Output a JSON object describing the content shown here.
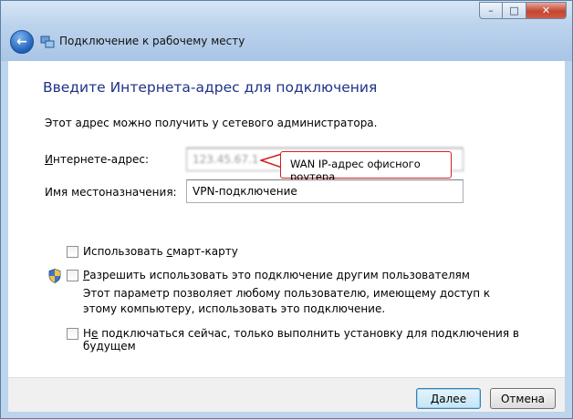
{
  "window": {
    "title": "Подключение к рабочему месту",
    "controls": {
      "minimize": "–",
      "maximize": "□",
      "close": "✕"
    }
  },
  "page": {
    "heading": "Введите Интернета-адрес для подключения",
    "description": "Этот адрес можно получить у сетевого администратора."
  },
  "fields": {
    "internet_address": {
      "label_pre": "",
      "label_u": "И",
      "label_post": "нтернете-адрес:",
      "value": "123.45.67.1"
    },
    "destination_name": {
      "label": "Имя местоназначения:",
      "value": "VPN-подключение"
    }
  },
  "callout": {
    "text": "WAN IP-адрес офисного роутера",
    "color": "#d21f1f"
  },
  "options": {
    "smart_card": {
      "pre": "Использовать ",
      "u": "с",
      "post": "март-карту",
      "checked": false
    },
    "allow_others": {
      "pre": "",
      "u": "Р",
      "post": "азрешить использовать это подключение другим пользователям",
      "checked": false,
      "note": "Этот параметр позволяет любому пользователю, имеющему доступ к этому компьютеру, использовать это подключение."
    },
    "dont_connect": {
      "pre": "Н",
      "u": "е",
      "post": " подключаться сейчас, только выполнить установку для подключения в будущем",
      "checked": false
    }
  },
  "buttons": {
    "next": "Далее",
    "cancel": "Отмена"
  },
  "icons": {
    "back": "back-arrow-icon",
    "app": "network-icon",
    "shield": "uac-shield-icon"
  }
}
